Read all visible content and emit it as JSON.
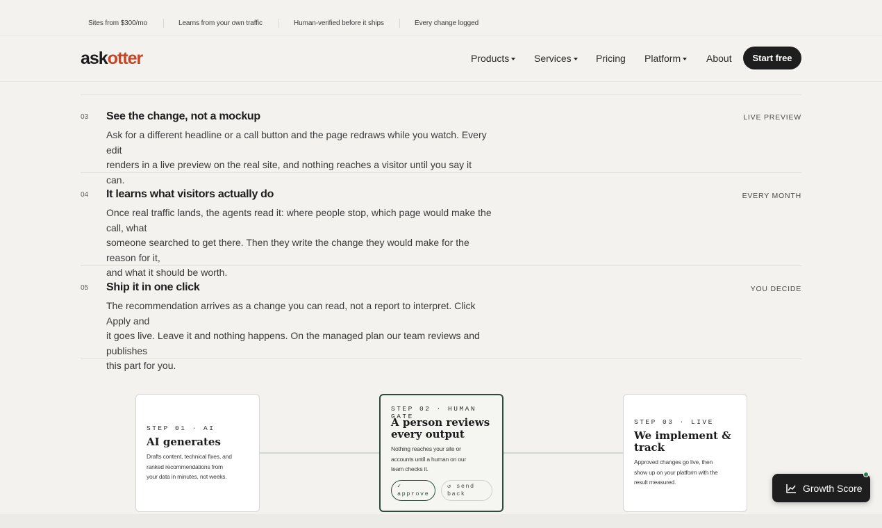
{
  "topstrip": [
    "Sites from $300/mo",
    "Learns from your own traffic",
    "Human-verified before it ships",
    "Every change logged"
  ],
  "nav": {
    "logo_part1": "ask",
    "logo_part2": "otter",
    "items": [
      "Products",
      "Services",
      "Pricing",
      "Platform",
      "About"
    ],
    "cta": "Start free"
  },
  "steps": [
    {
      "num": "03",
      "title": "See the change, not a mockup",
      "lines": [
        "Ask for a different headline or a call button and the page redraws while you watch. Every edit",
        "renders in a live preview on the real site, and nothing reaches a visitor until you say it can."
      ],
      "tag": "LIVE PREVIEW"
    },
    {
      "num": "04",
      "title": "It learns what visitors actually do",
      "lines": [
        "Once real traffic lands, the agents read it: where people stop, which page would make the call, what",
        "someone searched to get there. Then they write the change they would make for the reason for it,",
        "and what it should be worth."
      ],
      "tag": "EVERY MONTH"
    },
    {
      "num": "05",
      "title": "Ship it in one click",
      "lines": [
        "The recommendation arrives as a change you can read, not a report to interpret. Click Apply and",
        "it goes live. Leave it and nothing happens. On the managed plan our team reviews and publishes",
        "this part for you."
      ],
      "tag": "YOU DECIDE"
    }
  ],
  "cards": [
    {
      "step": "STEP 01 · AI",
      "title": [
        "AI generates"
      ],
      "body": [
        "Drafts content, technical fixes, and",
        "ranked recommendations from",
        "your data in minutes, not weeks."
      ]
    },
    {
      "step": "STEP 02 · HUMAN GATE",
      "title": [
        "A person reviews",
        "every output"
      ],
      "body": [
        "Nothing reaches your site or",
        "accounts until a human on our",
        "team checks it."
      ],
      "buttons": [
        "✓ approve",
        "↺ send back"
      ]
    },
    {
      "step": "STEP 03 · LIVE",
      "title": [
        "We implement &",
        "track"
      ],
      "body": [
        "Approved changes go live, then",
        "show up on your platform with the",
        "result measured."
      ]
    }
  ],
  "widget": {
    "label": "Growth Score"
  },
  "colors": {
    "accent": "#c94324",
    "dark": "#1e1e1e",
    "gate": "#2e4a3d"
  }
}
